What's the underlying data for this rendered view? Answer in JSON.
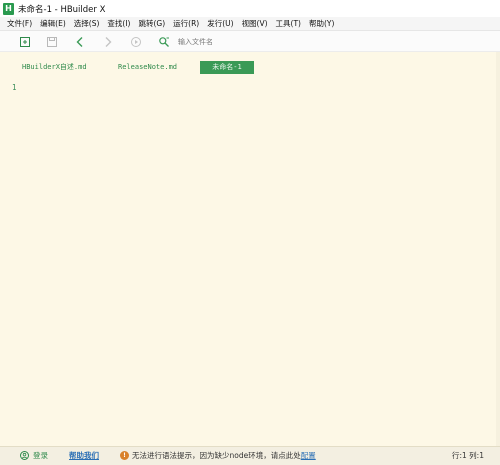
{
  "window": {
    "title": "未命名-1 - HBuilder X",
    "icon_name": "hbuilder-h-icon",
    "icon_glyph": "H"
  },
  "menu": [
    "文件(F)",
    "编辑(E)",
    "选择(S)",
    "查找(I)",
    "跳转(G)",
    "运行(R)",
    "发行(U)",
    "视图(V)",
    "工具(T)",
    "帮助(Y)"
  ],
  "toolbar": {
    "buttons": [
      "new-file-icon",
      "save-icon",
      "back-icon",
      "forward-icon",
      "run-icon",
      "search-file-icon"
    ],
    "file_search_placeholder": "输入文件名"
  },
  "tabs": [
    {
      "label": "HBuilderX自述.md",
      "active": false
    },
    {
      "label": "ReleaseNote.md",
      "active": false
    },
    {
      "label": "未命名-1",
      "active": true
    }
  ],
  "editor": {
    "line_numbers": [
      "1"
    ],
    "background_color": "#fdf8e6",
    "accent_color": "#3a9a56"
  },
  "statusbar": {
    "login_label": "登录",
    "help_label": "帮助我们",
    "warning_text": "无法进行语法提示，因为缺少node环境，请点此处",
    "warning_link": "配置",
    "cursor_position": "行:1  列:1"
  }
}
